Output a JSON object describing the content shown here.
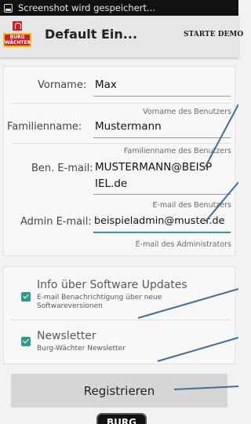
{
  "statusbar": {
    "text": "Screenshot wird gespeichert..."
  },
  "appbar": {
    "title": "Default Ein...",
    "demo_button": "STARTE DEMO",
    "logo_line1": "BURG",
    "logo_line2": "WÄCHTER"
  },
  "form": {
    "first_name": {
      "label": "Vorname:",
      "value": "Max",
      "hint": "Vorname des Benutzers"
    },
    "last_name": {
      "label": "Familienname:",
      "value": "Mustermann",
      "hint": "Familienname des Benutzers"
    },
    "user_email": {
      "label": "Ben. E-mail:",
      "value": "MUSTERMANN@BEISPIEL.de",
      "hint": "E-mail des Benutzers"
    },
    "admin_email": {
      "label": "Admin E-mail:",
      "value": "beispieladmin@muster.de",
      "hint": "E-mail des Administrators"
    }
  },
  "options": {
    "updates": {
      "title": "Info über Software Updates",
      "description": "E-mail Benachrichtigung über neue Softwareversionen",
      "checked": true
    },
    "newsletter": {
      "title": "Newsletter",
      "description": "Burg-Wächter Newsletter",
      "checked": true
    }
  },
  "register_button": "Registrieren",
  "bottom_logo": "BURG",
  "colors": {
    "accent": "#2a9a92",
    "annotation": "#3f6f9a"
  }
}
